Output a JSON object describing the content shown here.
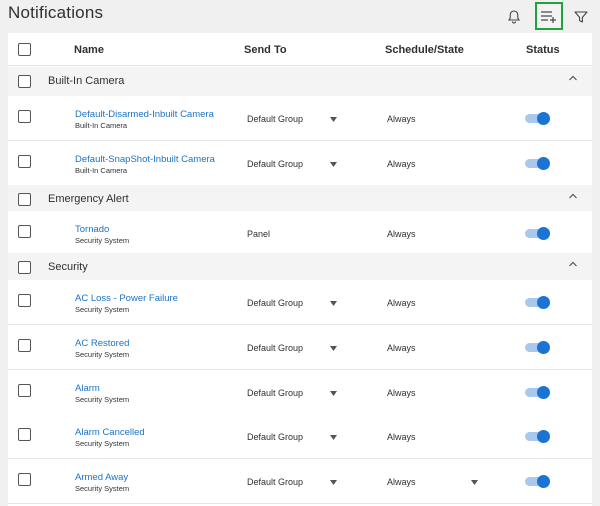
{
  "page": {
    "title": "Notifications"
  },
  "toolbar": {
    "icons": [
      "bell-icon",
      "add-list-icon",
      "filter-icon"
    ],
    "highlight_color": "#1fa33a"
  },
  "table": {
    "columns": {
      "name": "Name",
      "send_to": "Send To",
      "schedule": "Schedule/State",
      "status": "Status"
    },
    "groups": [
      {
        "label": "Built-In Camera"
      },
      {
        "label": "Emergency Alert"
      },
      {
        "label": "Security"
      }
    ],
    "rows": [
      {
        "name": "Default-Disarmed-Inbuilt Camera",
        "sub": "Built-In Camera",
        "send_to": "Default Group",
        "schedule": "Always",
        "enabled": true
      },
      {
        "name": "Default-SnapShot-Inbuilt Camera",
        "sub": "Built-In Camera",
        "send_to": "Default Group",
        "schedule": "Always",
        "enabled": true
      },
      {
        "name": "Tornado",
        "sub": "Security System",
        "send_to": "Panel",
        "schedule": "Always",
        "enabled": true
      },
      {
        "name": "AC Loss - Power Failure",
        "sub": "Security System",
        "send_to": "Default Group",
        "schedule": "Always",
        "enabled": true
      },
      {
        "name": "AC Restored",
        "sub": "Security System",
        "send_to": "Default Group",
        "schedule": "Always",
        "enabled": true
      },
      {
        "name": "Alarm",
        "sub": "Security System",
        "send_to": "Default Group",
        "schedule": "Always",
        "enabled": true
      },
      {
        "name": "Alarm Cancelled",
        "sub": "Security System",
        "send_to": "Default Group",
        "schedule": "Always",
        "enabled": true
      },
      {
        "name": "Armed Away",
        "sub": "Security System",
        "send_to": "Default Group",
        "schedule": "Always",
        "enabled": true
      }
    ]
  },
  "colors": {
    "link": "#1a73c8",
    "toggle_on": "#1b74d4",
    "toggle_track": "#a8c8ee"
  }
}
